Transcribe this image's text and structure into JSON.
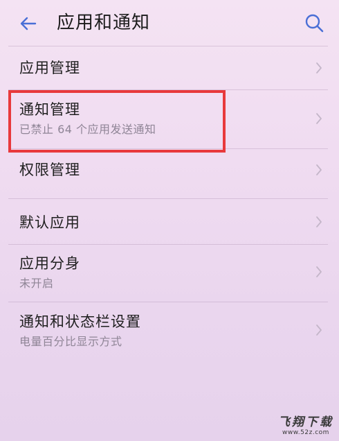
{
  "header": {
    "title": "应用和通知",
    "back_icon": "back-arrow-icon",
    "search_icon": "search-icon",
    "accent_color": "#4a6fd6"
  },
  "settings": {
    "items": [
      {
        "title": "应用管理",
        "subtitle": ""
      },
      {
        "title": "通知管理",
        "subtitle": "已禁止 64 个应用发送通知"
      },
      {
        "title": "权限管理",
        "subtitle": ""
      },
      {
        "title": "默认应用",
        "subtitle": ""
      },
      {
        "title": "应用分身",
        "subtitle": "未开启"
      },
      {
        "title": "通知和状态栏设置",
        "subtitle": "电量百分比显示方式"
      }
    ]
  },
  "highlight": {
    "color": "#e8393c"
  },
  "watermark": {
    "text": "飞翔下载",
    "url": "www.52z.com"
  }
}
